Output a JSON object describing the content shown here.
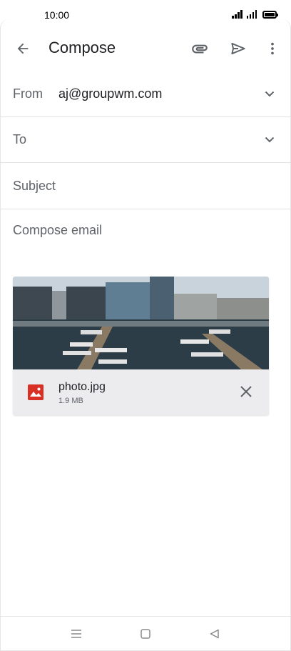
{
  "status_bar": {
    "time": "10:00"
  },
  "app_bar": {
    "title": "Compose",
    "icons": [
      "back-arrow-icon",
      "paperclip-icon",
      "send-icon",
      "more-vert-icon"
    ]
  },
  "fields": {
    "from": {
      "label": "From",
      "value": "aj@groupwm.com"
    },
    "to": {
      "label": "To",
      "value": ""
    },
    "subject": {
      "placeholder": "Subject"
    },
    "body": {
      "placeholder": "Compose email"
    }
  },
  "attachment": {
    "file_name": "photo.jpg",
    "file_size": "1.9 MB",
    "thumbnail": "harbor-marina-photo"
  },
  "nav_bar": {
    "icons": [
      "menu-icon",
      "home-icon",
      "back-icon"
    ]
  },
  "colors": {
    "accent_image_icon": "#d93025",
    "icon_gray": "#5f6368",
    "attachment_bg": "#ececee"
  }
}
